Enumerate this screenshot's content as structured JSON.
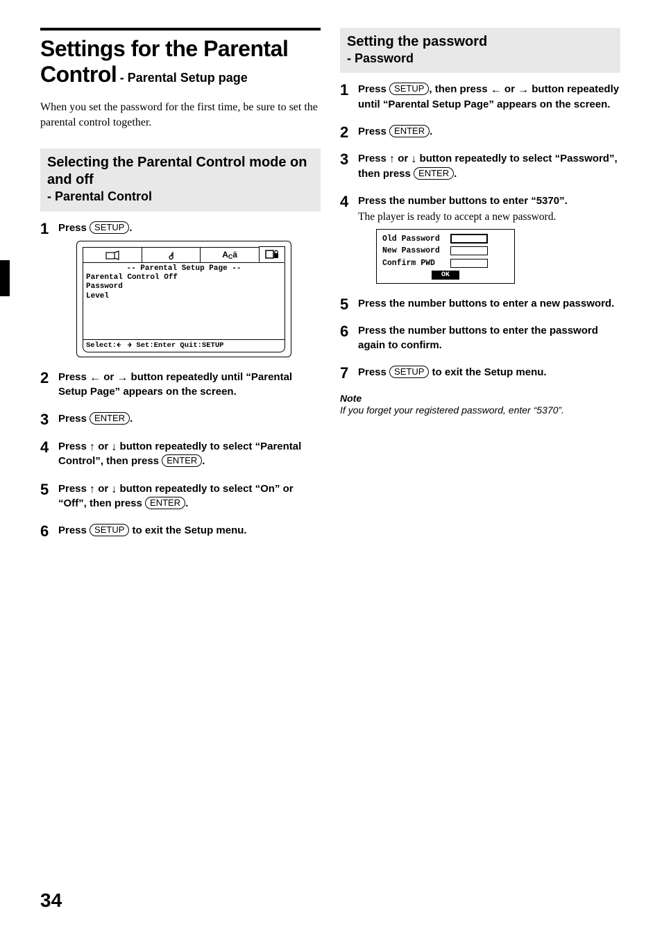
{
  "page_number": "34",
  "main_title": "Settings for the Parental Control",
  "main_title_sub": "- Parental Setup page",
  "intro_text": "When you set the password for the first time, be sure to set the parental control together.",
  "left_section": {
    "title": "Selecting the Parental Control mode on and off",
    "subtitle": "- Parental Control",
    "steps": [
      {
        "text_before": "Press ",
        "button": "SETUP",
        "text_after": "."
      },
      {
        "text_before": "Press ",
        "arrow1": "←",
        "mid": " or ",
        "arrow2": "→",
        "text_after": " button repeatedly until “Parental Setup Page” appears on the screen."
      },
      {
        "text_before": "Press ",
        "button": "ENTER",
        "text_after": "."
      },
      {
        "text_before": "Press ",
        "arrow1": "↑",
        "mid": " or ",
        "arrow2": "↓",
        "text_after": " button repeatedly to select “Parental Control”, then press ",
        "button2": "ENTER",
        "end": "."
      },
      {
        "text_before": "Press ",
        "arrow1": "↑",
        "mid": " or ",
        "arrow2": "↓",
        "text_after": " button repeatedly to select “On” or “Off”, then press ",
        "button2": "ENTER",
        "end": "."
      },
      {
        "text_before": "Press ",
        "button": "SETUP",
        "text_after": " to exit the Setup menu."
      }
    ]
  },
  "right_section": {
    "title": "Setting the password",
    "subtitle": "- Password",
    "steps": [
      {
        "text_before": "Press ",
        "button": "SETUP",
        "mid": ", then press ",
        "arrow1": "←",
        "mid2": " or ",
        "arrow2": "→",
        "text_after": " button repeatedly until “Parental Setup Page” appears on the screen."
      },
      {
        "text_before": "Press ",
        "button": "ENTER",
        "text_after": "."
      },
      {
        "text_before": "Press ",
        "arrow1": "↑",
        "mid": " or ",
        "arrow2": "↓",
        "text_after": " button repeatedly to select “Password”, then press ",
        "button2": "ENTER",
        "end": "."
      },
      {
        "text_before": "Press the number buttons to enter “5370”.",
        "sub": "The player is ready to accept a new password."
      },
      {
        "text_before": "Press the number buttons to enter a new password."
      },
      {
        "text_before": "Press the number buttons to enter the password again to confirm."
      },
      {
        "text_before": "Press ",
        "button": "SETUP",
        "text_after": " to exit the Setup menu."
      }
    ],
    "note_head": "Note",
    "note_body": "If you forget your registered password, enter “5370”."
  },
  "screen_diagram": {
    "header": "-- Parental Setup Page --",
    "lines": [
      "Parental Control Off",
      "Password",
      "Level"
    ],
    "footer_prefix": "Select:",
    "footer_suffix": " Set:Enter Quit:SETUP"
  },
  "pw_diagram": {
    "rows": [
      "Old Password",
      "New Password",
      "Confirm PWD"
    ],
    "ok": "OK"
  }
}
